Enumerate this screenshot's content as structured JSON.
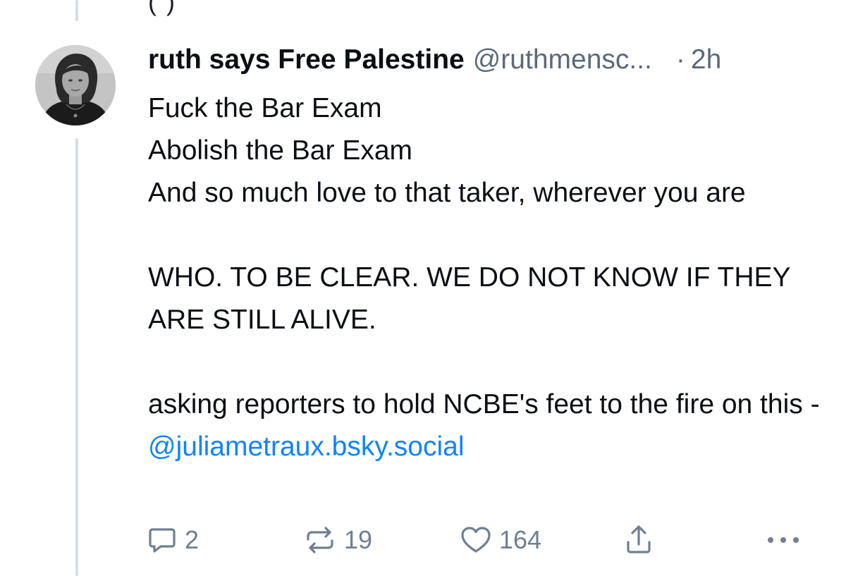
{
  "thread": {
    "previous_fragment": "(                   )"
  },
  "post": {
    "author_name": "ruth says Free Palestine",
    "handle": "@ruthmensc...",
    "separator": "·",
    "time": "2h",
    "lines": [
      "Fuck the Bar Exam",
      "Abolish the Bar Exam",
      "And so much love to that taker, wherever you are",
      "WHO. TO BE CLEAR. WE DO NOT KNOW IF THEY ARE STILL ALIVE.",
      "asking reporters to hold NCBE's feet to the fire on this - "
    ],
    "mention": "@juliametraux.bsky.social"
  },
  "actions": {
    "reply_icon": "reply-icon",
    "reply_count": "2",
    "repost_icon": "repost-icon",
    "repost_count": "19",
    "like_icon": "heart-icon",
    "like_count": "164",
    "share_icon": "share-icon",
    "more_icon": "more-options-icon"
  },
  "colors": {
    "text": "#0b0f14",
    "muted": "#5b6a7a",
    "icon": "#6f7f90",
    "link": "#1083fe",
    "thread_line": "#d6dde4"
  }
}
